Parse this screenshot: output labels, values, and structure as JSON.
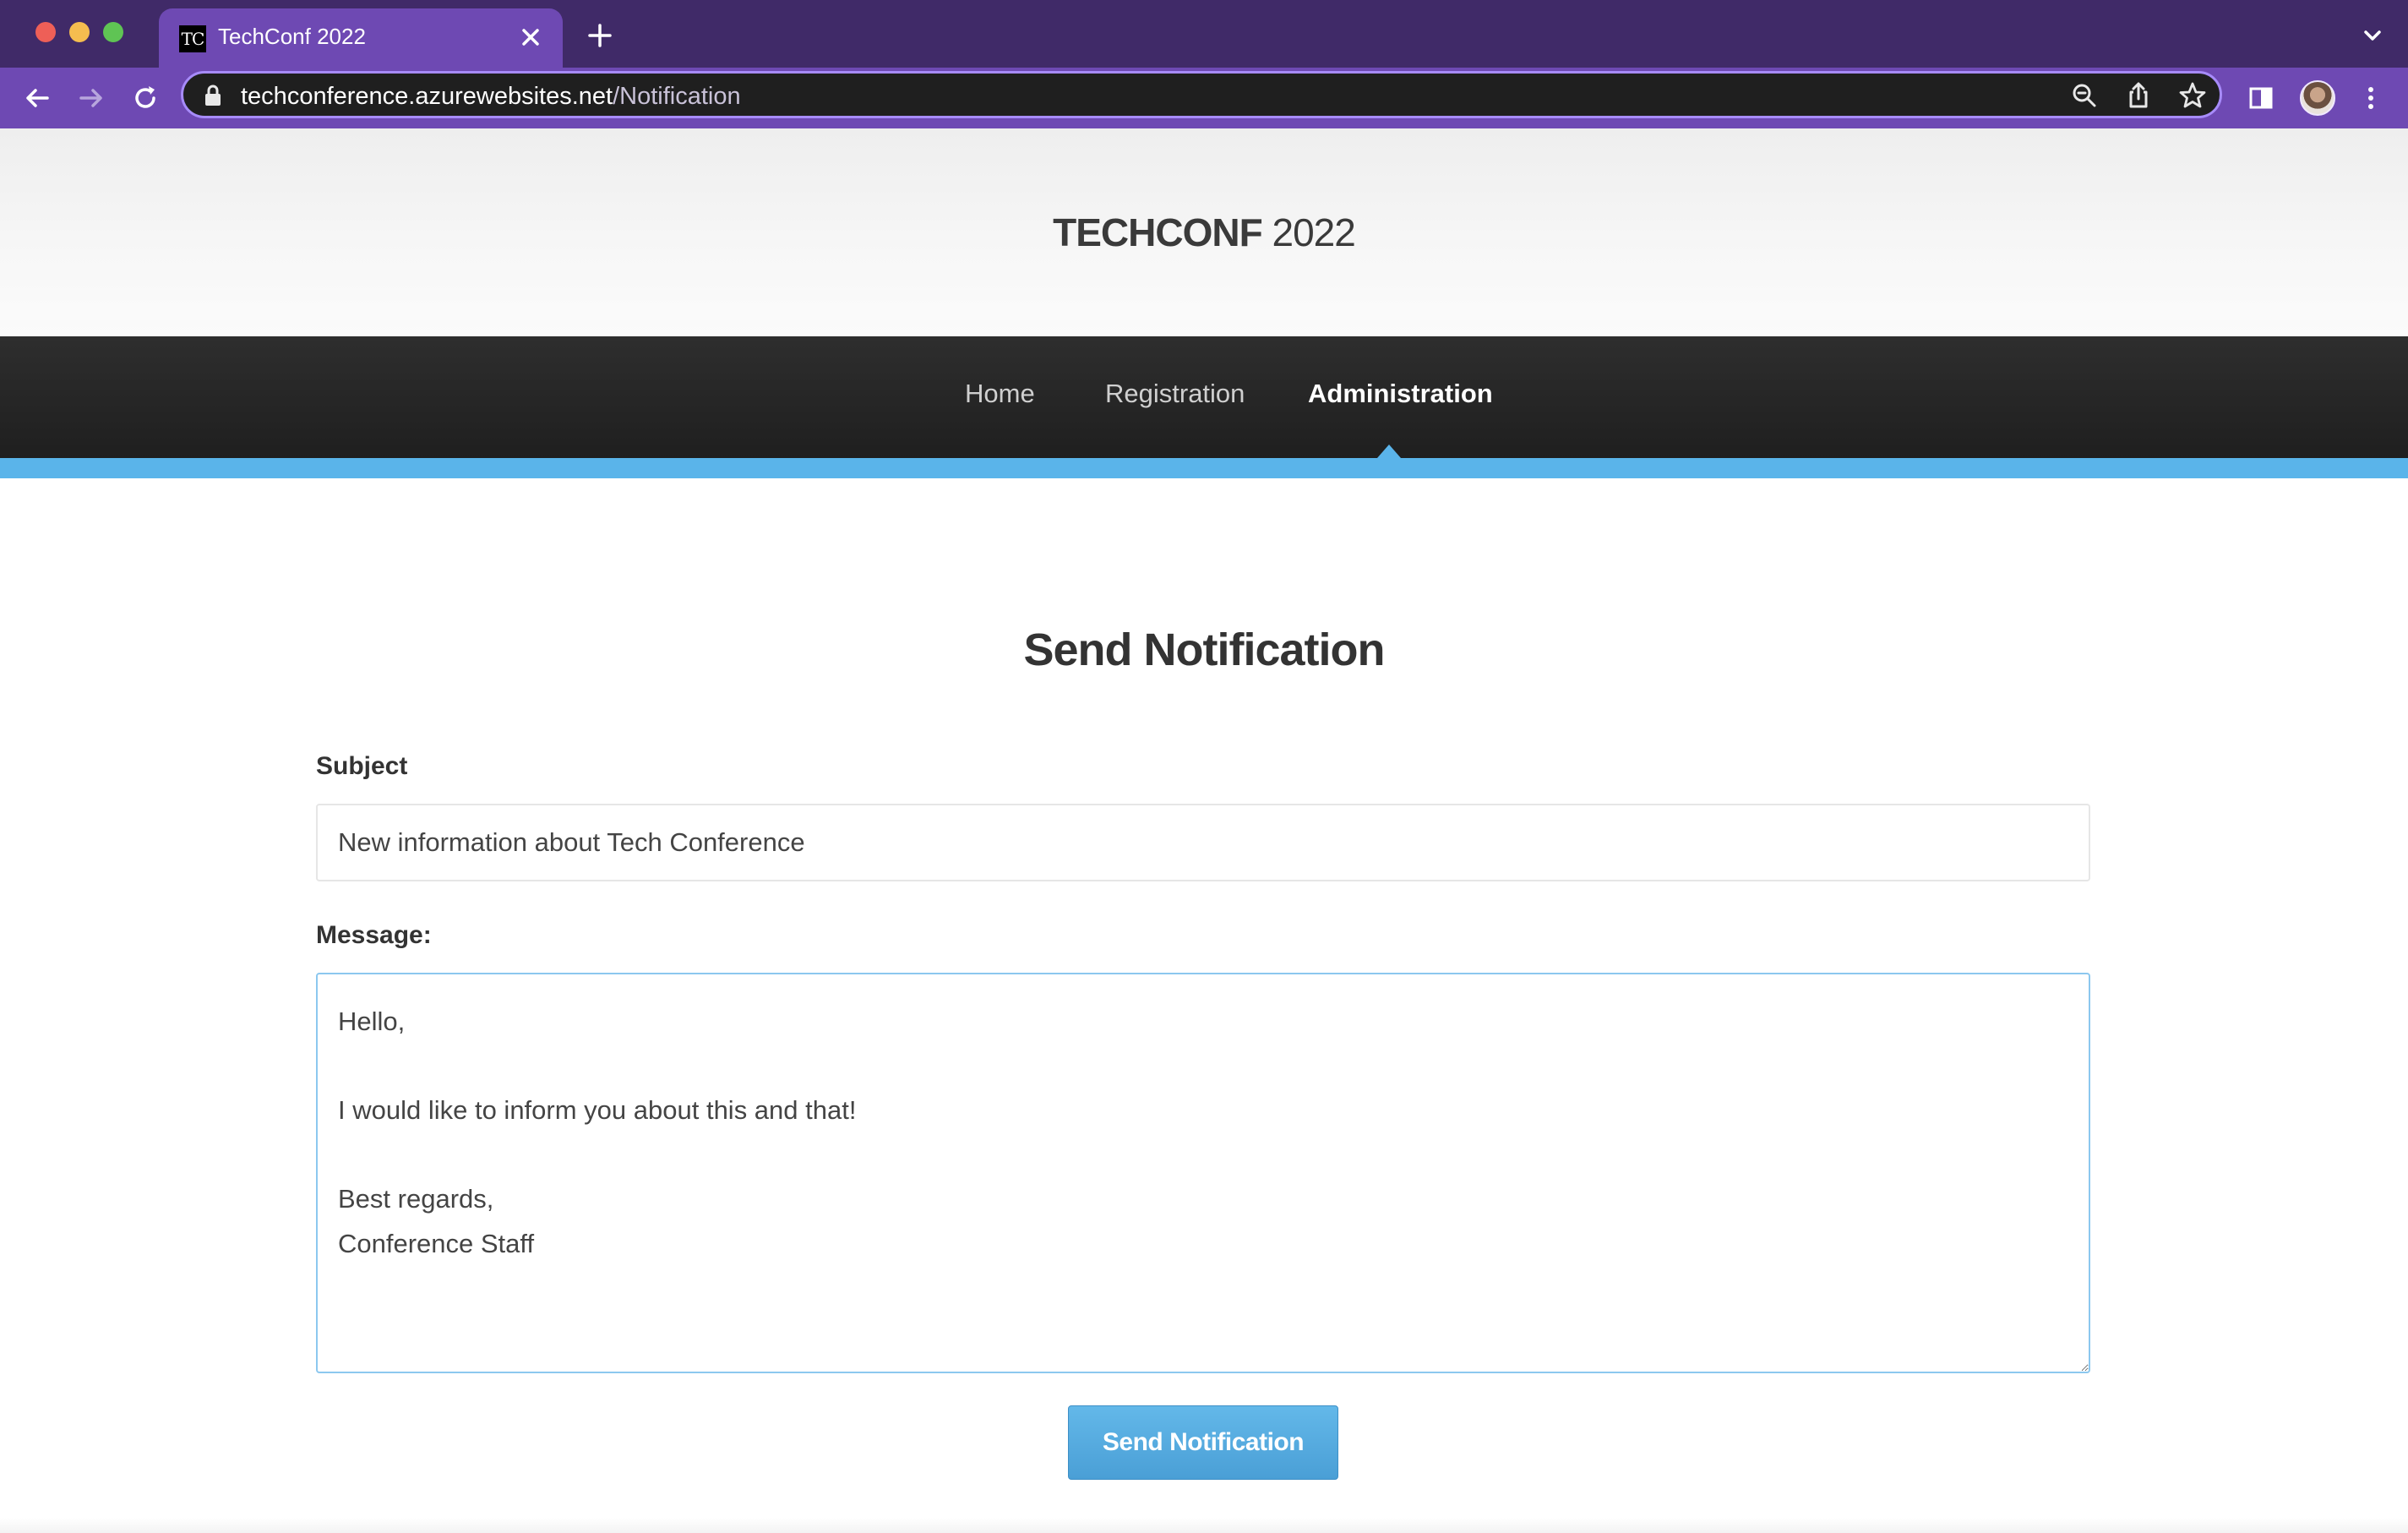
{
  "browser": {
    "tab": {
      "favicon_text": "TC",
      "title": "TechConf 2022"
    },
    "url": {
      "host": "techconference.azurewebsites.net",
      "path": "/Notification"
    },
    "icons": {
      "close_tab": "close-icon",
      "new_tab": "plus-icon",
      "back": "back-arrow-icon",
      "forward": "forward-arrow-icon",
      "reload": "reload-icon",
      "lock": "lock-icon",
      "zoom": "zoom-icon",
      "share": "share-icon",
      "bookmark": "star-icon",
      "side_panel": "side-panel-icon",
      "profile": "avatar-icon",
      "menu": "more-vertical-icon",
      "tab_search": "chevron-down-icon"
    },
    "colors": {
      "tabstrip": "#402a68",
      "toolbar": "#6e49b3",
      "omnibox": "#1f1f1f"
    }
  },
  "site": {
    "brand_bold": "TECHCONF",
    "brand_year": "2022",
    "nav": [
      {
        "label": "Home",
        "active": false
      },
      {
        "label": "Registration",
        "active": false
      },
      {
        "label": "Administration",
        "active": true
      }
    ],
    "accent_color": "#5ab4ea"
  },
  "form": {
    "title": "Send Notification",
    "subject_label": "Subject",
    "subject_value": "New information about Tech Conference",
    "message_label": "Message:",
    "message_value": "Hello,\n\nI would like to inform you about this and that!\n\nBest regards,\nConference Staff",
    "submit_label": "Send Notification"
  }
}
